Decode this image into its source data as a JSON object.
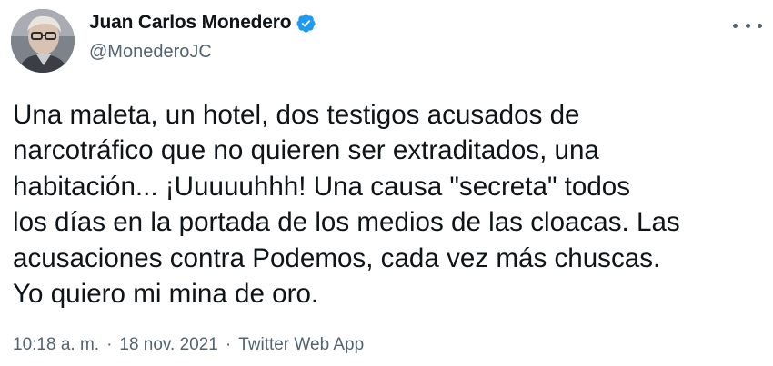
{
  "author": {
    "name": "Juan Carlos Monedero",
    "handle": "@MonederoJC",
    "verified": true,
    "verified_color": "#1d9bf0"
  },
  "tweet": {
    "text": "Una maleta, un hotel, dos testigos acusados de\nnarcotráfico que no quieren ser extraditados, una\nhabitación... ¡Uuuuuhhh! Una causa \"secreta\" todos\nlos días en la portada de los medios de las cloacas. Las\nacusaciones contra Podemos, cada vez más chuscas.\nYo quiero mi mina de oro.",
    "time": "10:18 a. m.",
    "separator": "·",
    "date": "18 nov. 2021",
    "source": "Twitter Web App"
  },
  "icons": {
    "more": "more-horizontal-icon",
    "verified": "verified-badge-icon"
  }
}
